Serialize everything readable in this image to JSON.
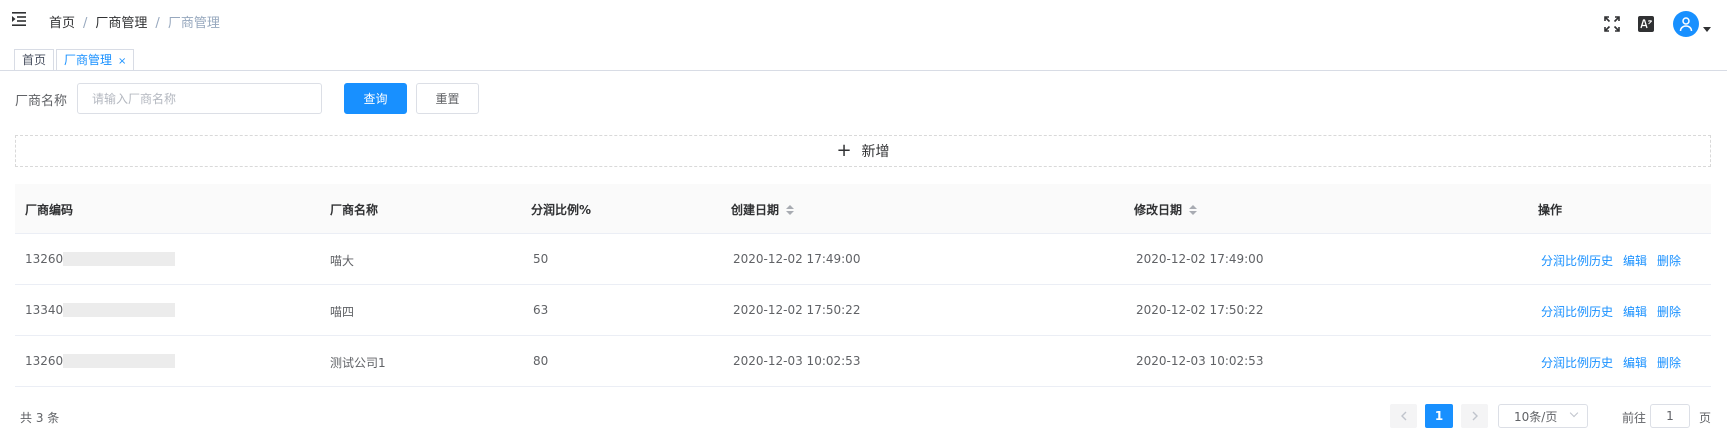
{
  "breadcrumb": {
    "home": "首页",
    "parent": "厂商管理",
    "current": "厂商管理",
    "separator": "/"
  },
  "header_icons": [
    "fullscreen-icon",
    "translate-icon",
    "user-avatar-icon"
  ],
  "tags": [
    {
      "label": "首页",
      "active": false
    },
    {
      "label": "厂商管理",
      "active": true,
      "close": "×"
    }
  ],
  "search": {
    "label": "厂商名称",
    "placeholder": "请输入厂商名称",
    "value": "",
    "query_button": "查询",
    "reset_button": "重置"
  },
  "add_button": {
    "icon": "+",
    "label": "新增"
  },
  "table": {
    "columns": [
      "厂商编码",
      "厂商名称",
      "分润比例%",
      "创建日期",
      "修改日期",
      "操作"
    ],
    "rows": [
      {
        "code": "13260",
        "name": "喵大",
        "ratio": "50",
        "created": "2020-12-02 17:49:00",
        "modified": "2020-12-02 17:49:00"
      },
      {
        "code": "13340",
        "name": "喵四",
        "ratio": "63",
        "created": "2020-12-02 17:50:22",
        "modified": "2020-12-02 17:50:22"
      },
      {
        "code": "13260",
        "name": "测试公司1",
        "ratio": "80",
        "created": "2020-12-03 10:02:53",
        "modified": "2020-12-03 10:02:53"
      }
    ],
    "actions": {
      "history": "分润比例历史",
      "edit": "编辑",
      "delete": "删除"
    }
  },
  "pagination": {
    "total": "共 3 条",
    "current_page": "1",
    "page_size": "10条/页",
    "goto_label": "前往",
    "goto_value": "1",
    "goto_unit": "页"
  },
  "colors": {
    "primary": "#1890ff",
    "text": "#303133",
    "muted": "#606266"
  }
}
